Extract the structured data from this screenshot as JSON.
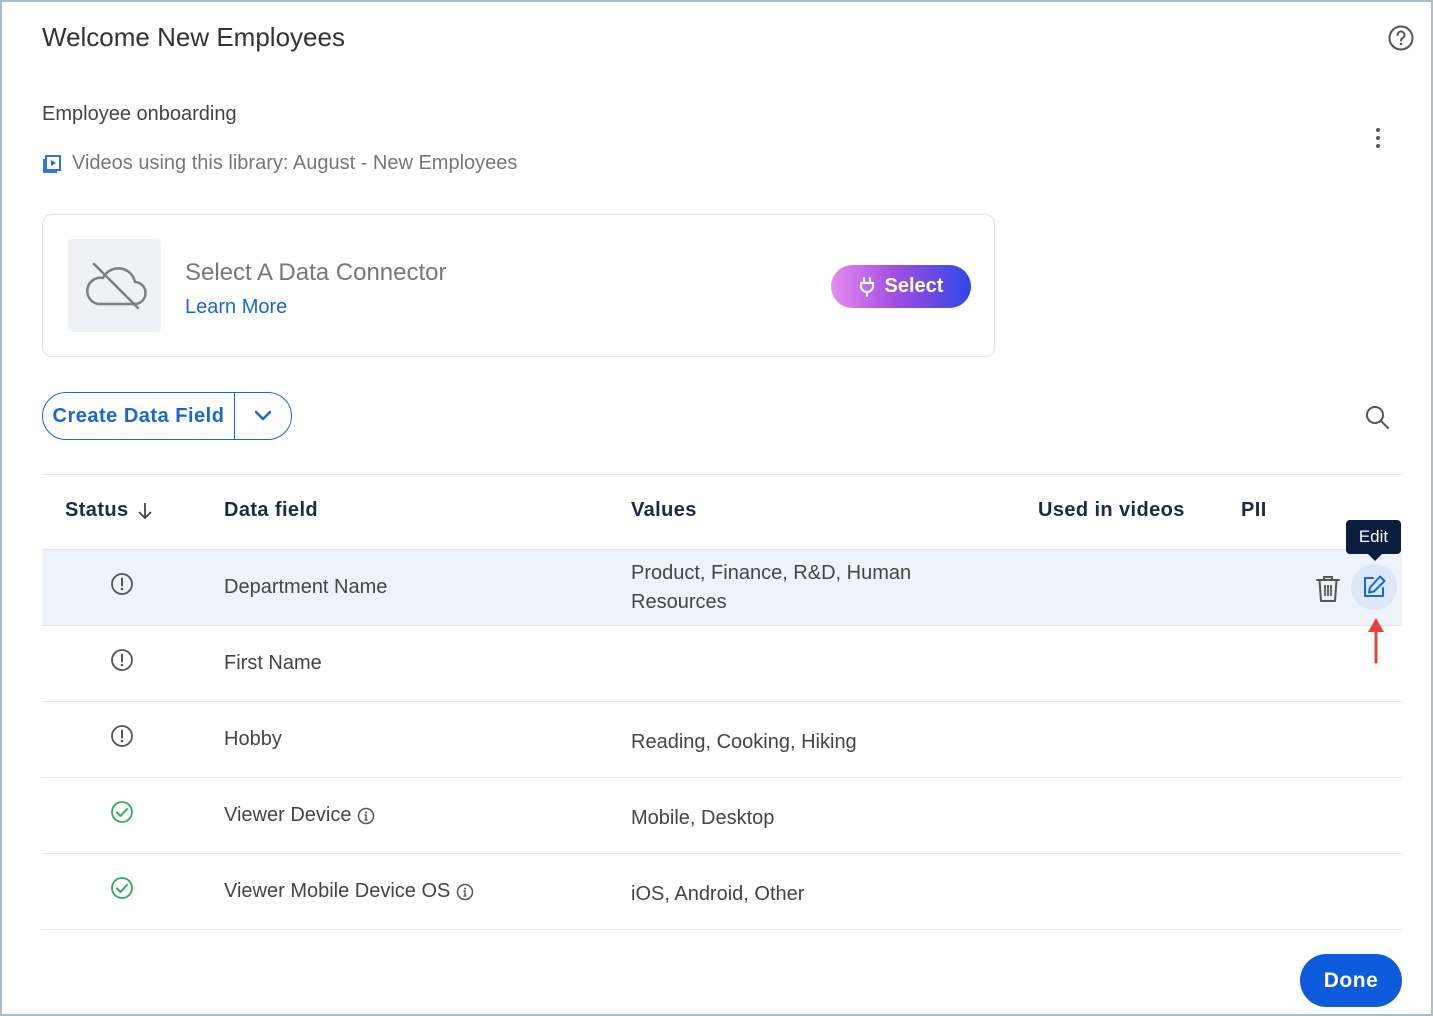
{
  "dialog": {
    "title": "Welcome New Employees",
    "subtitle": "Employee onboarding",
    "videos_line": "Videos using this library: August - New Employees"
  },
  "connector": {
    "title": "Select A Data Connector",
    "learn_more": "Learn More",
    "select_label": "Select"
  },
  "toolbar": {
    "create_label": "Create Data Field"
  },
  "table": {
    "headers": {
      "status": "Status",
      "data_field": "Data field",
      "values": "Values",
      "used_in_videos": "Used in videos",
      "pii": "PII"
    },
    "rows": [
      {
        "status": "warning",
        "field": "Department Name",
        "values": "Product, Finance, R&D, Human Resources",
        "info": false
      },
      {
        "status": "warning",
        "field": "First Name",
        "values": "",
        "info": false
      },
      {
        "status": "warning",
        "field": "Hobby",
        "values": "Reading, Cooking, Hiking",
        "info": false
      },
      {
        "status": "ok",
        "field": "Viewer Device",
        "values": "Mobile, Desktop",
        "info": true
      },
      {
        "status": "ok",
        "field": "Viewer Mobile Device OS",
        "values": "iOS, Android, Other",
        "info": true
      }
    ]
  },
  "tooltip": {
    "label": "Edit"
  },
  "footer": {
    "done_label": "Done"
  },
  "colors": {
    "accent": "#1a66d9",
    "done": "#0d5bdc",
    "ok_status": "#2fae5a",
    "warning_status": "#555555",
    "annotation_arrow": "#e8423f",
    "highlight_row": "#eef3fb"
  }
}
